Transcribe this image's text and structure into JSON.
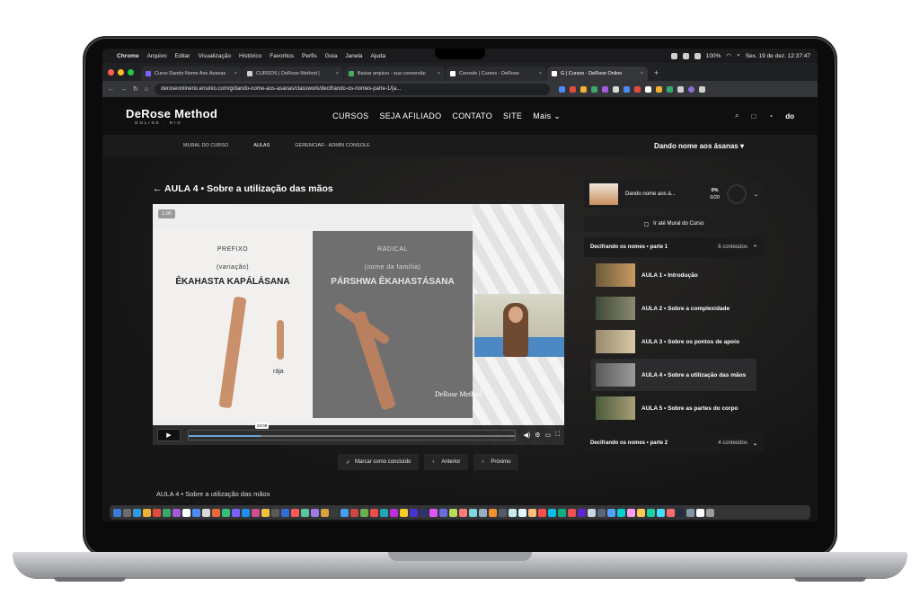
{
  "menubar": {
    "app": "Chrome",
    "items": [
      "Arquivo",
      "Editar",
      "Visualização",
      "Histórico",
      "Favoritos",
      "Perfis",
      "Guia",
      "Janela",
      "Ajuda"
    ],
    "battery": "100%",
    "datetime": "Sex. 19 de dez.  12:37:47"
  },
  "browser": {
    "tabs": [
      {
        "label": "Curso Dando Nome Aos Ásanas"
      },
      {
        "label": "CURSOS | DeRose Method |"
      },
      {
        "label": "Baixar arquivo - sua conversão"
      },
      {
        "label": "Console | Cursos - DeRose"
      },
      {
        "label": "G | Cursos - DeRose Online"
      }
    ],
    "url": "deroseonlinerio.ensinio.com/g/dando-nome-aos-asanas/classwork/decifrando-os-nomes-parte-1/{a..."
  },
  "site": {
    "logo_main": "DeRose Method",
    "logo_sub": "ONLINE · RIO",
    "nav": [
      "CURSOS",
      "SEJA AFILIADO",
      "CONTATO",
      "SITE",
      "Mais ⌄"
    ],
    "avatar": "do"
  },
  "subnav": {
    "links": [
      "MURAL DO CURSO",
      "AULAS",
      "GERENCIAR - ADMIN CONSOLE"
    ],
    "course": "Dando nome aos ásanas"
  },
  "lesson": {
    "back_title": "AULA 4 • Sobre a utilização das mãos",
    "speed": "1.00",
    "left_panel": {
      "heading": "PREFIXO",
      "sub": "(variação)",
      "name": "ÊKAHASTA KAPÁLÁSANA",
      "raja": "rája"
    },
    "right_panel": {
      "heading": "RADICAL",
      "sub": "(nome da família)",
      "name": "PÁRSHWA ÊKAHASTÁSANA"
    },
    "brand_mark": "DeRose Method",
    "time_tip": "03:09",
    "progress_fraction": 0.22,
    "actions": {
      "complete": "Marcar como concluído",
      "prev": "Anterior",
      "next": "Próximo"
    },
    "bottom_title": "AULA 4 • Sobre a utilização das mãos"
  },
  "sidebar": {
    "course_name": "Dando nome aos á...",
    "progress_pct": "0%",
    "progress_count": "0/20",
    "mural_button": "Ir até Mural do Curso",
    "section1": {
      "title": "Decifrando os nomes • parte 1",
      "count": "6 conteúdos"
    },
    "lessons": [
      {
        "label": "AULA 1 • Introdução",
        "active": false
      },
      {
        "label": "AULA 2 • Sobre a complexidade",
        "active": false
      },
      {
        "label": "AULA 3 • Sobre os pontos de apoio",
        "active": false
      },
      {
        "label": "AULA 4 • Sobre a utilização das mãos",
        "active": true
      },
      {
        "label": "AULA 5 • Sobre as partes do corpo",
        "active": false
      }
    ],
    "section2": {
      "title": "Decifrando os nomes • parte 2",
      "count": "4 conteúdos"
    }
  },
  "colors": {
    "accent_blue": "#6fa3d8",
    "background": "#141415"
  }
}
